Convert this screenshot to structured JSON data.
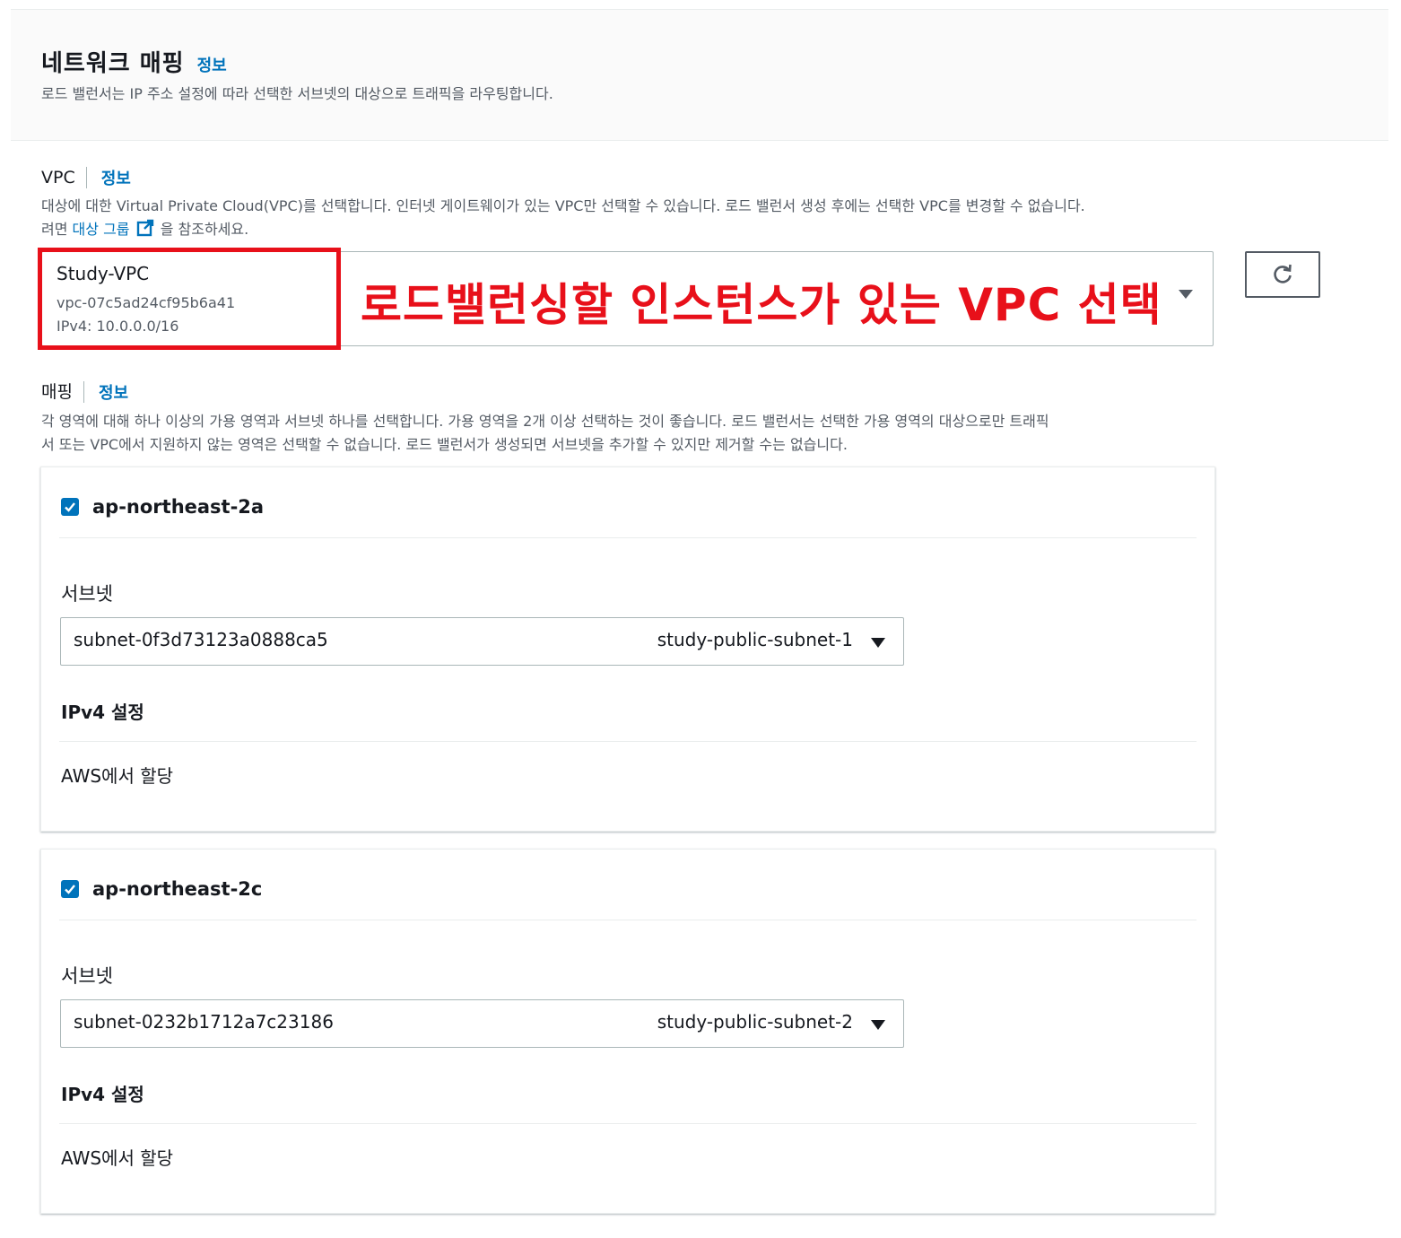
{
  "header": {
    "title": "네트워크 매핑",
    "info_link": "정보",
    "description": "로드 밸런서는 IP 주소 설정에 따라 선택한 서브넷의 대상으로 트래픽을 라우팅합니다."
  },
  "vpc": {
    "label": "VPC",
    "info_link": "정보",
    "description_line1": "대상에 대한 Virtual Private Cloud(VPC)를 선택합니다. 인터넷 게이트웨이가 있는 VPC만 선택할 수 있습니다. 로드 밸런서 생성 후에는 선택한 VPC를 변경할 수 없습니다.",
    "description_line2_prefix": "려면",
    "description_link": "대상 그룹",
    "description_line2_suffix": "을 참조하세요.",
    "selected": {
      "name": "Study-VPC",
      "id": "vpc-07c5ad24cf95b6a41",
      "cidr": "IPv4: 10.0.0.0/16"
    },
    "annotation": "로드밸런싱할 인스턴스가 있는 VPC 선택"
  },
  "mapping": {
    "label": "매핑",
    "info_link": "정보",
    "description_line1": "각 영역에 대해 하나 이상의 가용 영역과 서브넷 하나를 선택합니다. 가용 영역을 2개 이상 선택하는 것이 좋습니다. 로드 밸런서는 선택한 가용 영역의 대상으로만 트래픽",
    "description_line2": "서 또는 VPC에서 지원하지 않는 영역은 선택할 수 없습니다. 로드 밸런서가 생성되면 서브넷을 추가할 수 있지만 제거할 수는 없습니다.",
    "zones": [
      {
        "name": "ap-northeast-2a",
        "checked": true,
        "subnet_label": "서브넷",
        "subnet_id": "subnet-0f3d73123a0888ca5",
        "subnet_name": "study-public-subnet-1",
        "ipv4_title": "IPv4 설정",
        "ipv4_value": "AWS에서 할당"
      },
      {
        "name": "ap-northeast-2c",
        "checked": true,
        "subnet_label": "서브넷",
        "subnet_id": "subnet-0232b1712a7c23186",
        "subnet_name": "study-public-subnet-2",
        "ipv4_title": "IPv4 설정",
        "ipv4_value": "AWS에서 할당"
      }
    ]
  },
  "icons": {
    "refresh": "refresh-icon",
    "external_link": "external-link-icon",
    "checkbox": "checkbox-checked-icon",
    "caret": "caret-down-icon"
  },
  "colors": {
    "link": "#0073bb",
    "annotation_red": "#e8101a",
    "checkbox_blue": "#0073bb",
    "header_bg": "#fafafa"
  }
}
